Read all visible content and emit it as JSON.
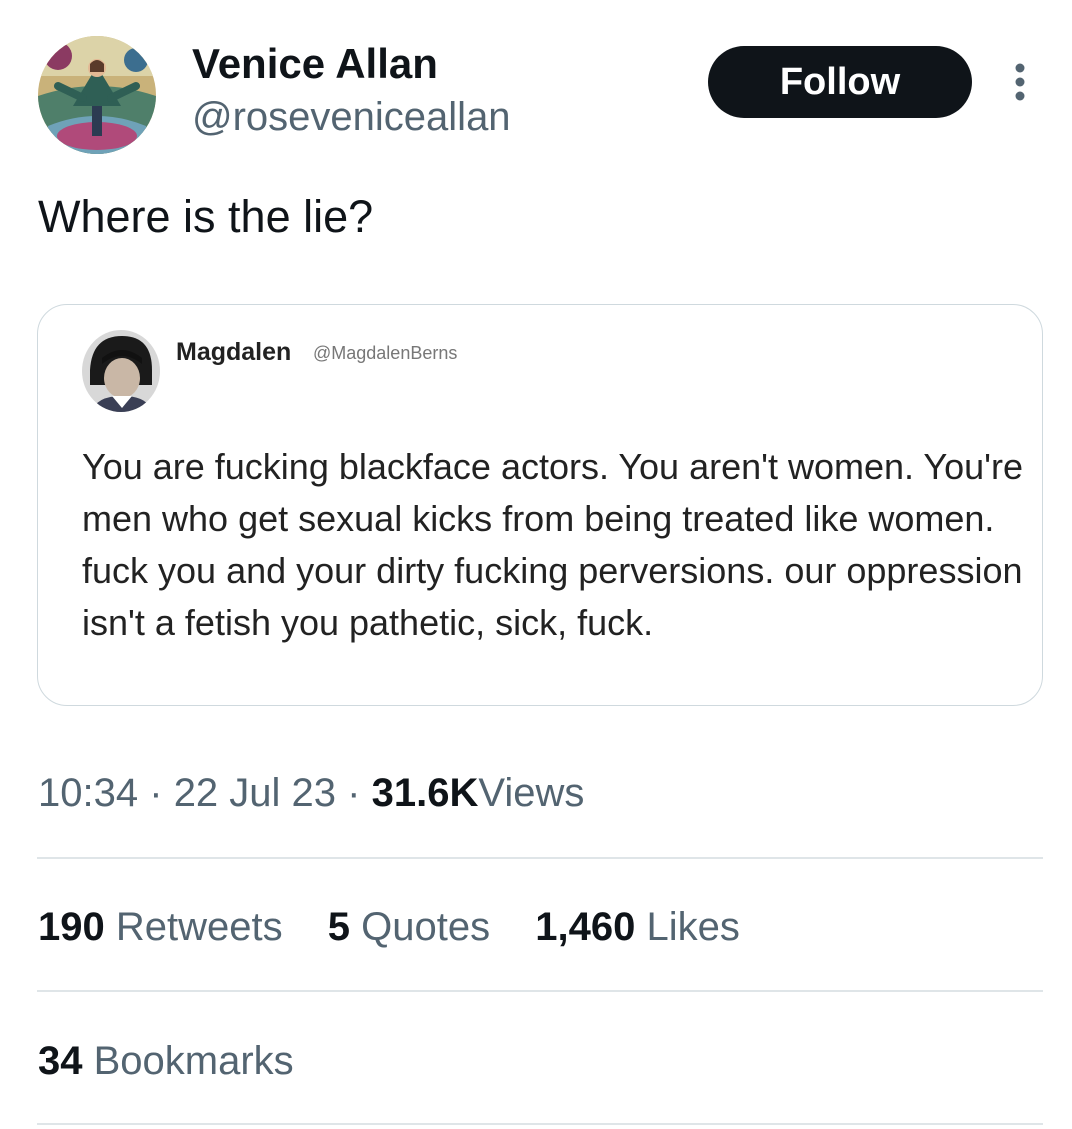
{
  "author": {
    "display_name": "Venice Allan",
    "handle": "@roseveniceallan",
    "avatar_icon": "profile-avatar"
  },
  "follow_label": "Follow",
  "more_icon": "more-options-icon",
  "tweet": {
    "text": "Where is the lie?"
  },
  "quoted": {
    "name": "Magdalen",
    "handle": "@MagdalenBerns",
    "text": "You are fucking blackface actors. You aren't women. You're men who get sexual kicks from being treated like women. fuck you and your dirty fucking perversions. our oppression isn't a fetish you pathetic, sick, fuck."
  },
  "meta": {
    "time": "10:34",
    "separator": "·",
    "date": "22 Jul 23",
    "views_count": "31.6K",
    "views_label": "Views"
  },
  "stats": {
    "retweets_count": "190",
    "retweets_label": "Retweets",
    "quotes_count": "5",
    "quotes_label": "Quotes",
    "likes_count": "1,460",
    "likes_label": "Likes",
    "bookmarks_count": "34",
    "bookmarks_label": "Bookmarks"
  },
  "colors": {
    "text_primary": "#0f1419",
    "text_secondary": "#536471",
    "border": "#cfd9de",
    "button_bg": "#0f1419"
  }
}
